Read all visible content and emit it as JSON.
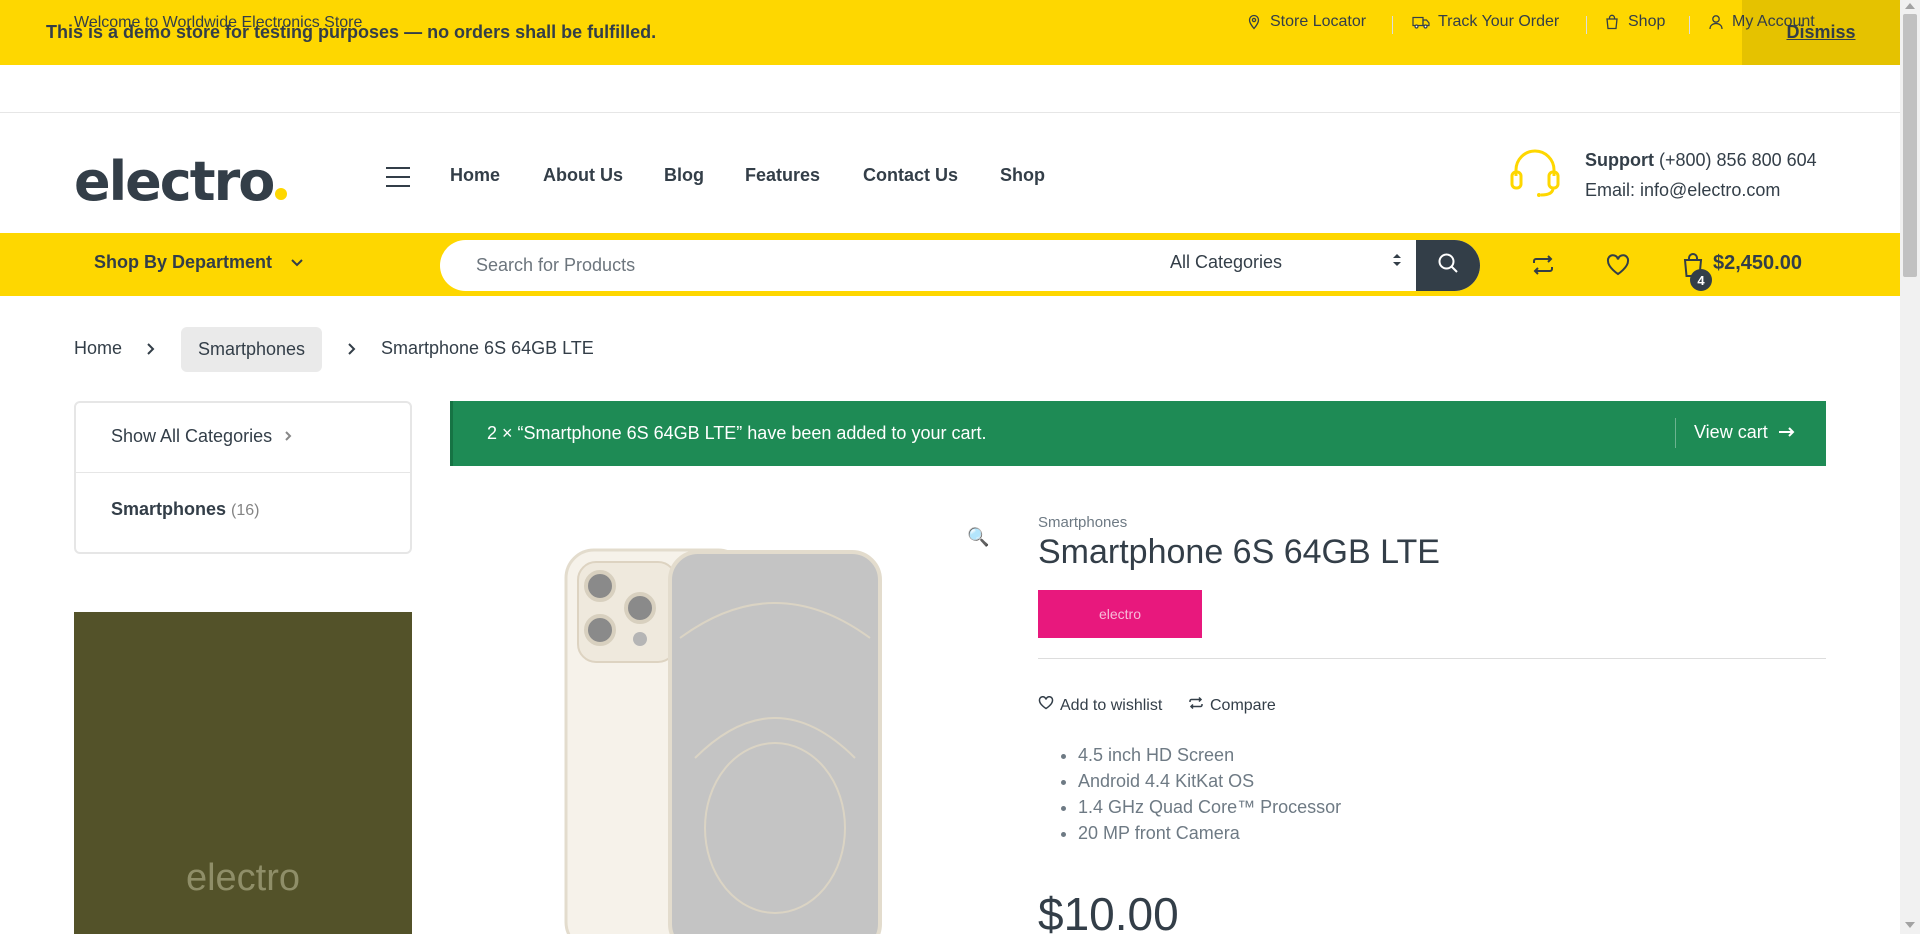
{
  "notice": {
    "text": "This is a demo store for testing purposes — no orders shall be fulfilled.",
    "dismiss_label": "Dismiss"
  },
  "topbar": {
    "welcome": "Welcome to Worldwide Electronics Store",
    "links": [
      {
        "label": "Store Locator",
        "icon": "map-pin-icon"
      },
      {
        "label": "Track Your Order",
        "icon": "truck-icon"
      },
      {
        "label": "Shop",
        "icon": "shopping-bag-icon"
      },
      {
        "label": "My Account",
        "icon": "user-icon"
      }
    ]
  },
  "header": {
    "logo_text": "electro",
    "nav": [
      "Home",
      "About Us",
      "Blog",
      "Features",
      "Contact Us",
      "Shop"
    ],
    "support_label": "Support",
    "support_phone": "(+800) 856 800 604",
    "email": "Email: info@electro.com"
  },
  "navbar": {
    "department_label": "Shop By Department",
    "search_placeholder": "Search for Products",
    "category_selected": "All Categories",
    "cart_count": "4",
    "cart_total": "$2,450.00"
  },
  "breadcrumb": [
    "Home",
    "Smartphones",
    "Smartphone 6S 64GB LTE"
  ],
  "sidebar": {
    "show_all": "Show All Categories",
    "category": "Smartphones",
    "category_count": "(16)",
    "banner_text": "electro"
  },
  "message": {
    "text": "2 × “Smartphone 6S 64GB LTE” have been added to your cart.",
    "view_cart": "View cart"
  },
  "product": {
    "category": "Smartphones",
    "title": "Smartphone 6S 64GB LTE",
    "brand": "electro",
    "wishlist_label": "Add to wishlist",
    "compare_label": "Compare",
    "features": [
      "4.5 inch HD Screen",
      "Android 4.4 KitKat OS",
      "1.4 GHz Quad Core™ Processor",
      "20 MP front Camera"
    ],
    "price": "$10.00"
  },
  "colors": {
    "accent": "#fed700",
    "text": "#333e48",
    "success": "#1e8b55",
    "brand_badge": "#e8187d"
  }
}
